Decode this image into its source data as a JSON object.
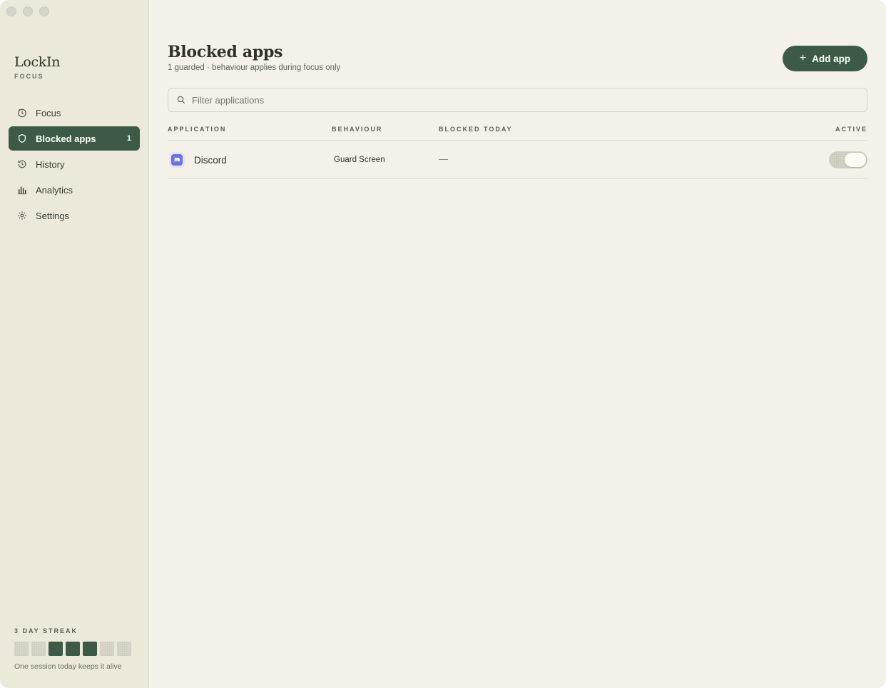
{
  "app": {
    "name": "LockIn",
    "subtitle": "FOCUS"
  },
  "sidebar": {
    "items": [
      {
        "label": "Focus",
        "icon": "timer-icon"
      },
      {
        "label": "Blocked apps",
        "icon": "shield-icon",
        "badge": "1",
        "active": true
      },
      {
        "label": "History",
        "icon": "history-icon"
      },
      {
        "label": "Analytics",
        "icon": "bar-chart-icon"
      },
      {
        "label": "Settings",
        "icon": "gear-icon"
      }
    ],
    "streak": {
      "title": "3 DAY STREAK",
      "days": [
        false,
        false,
        true,
        true,
        true,
        false,
        false
      ],
      "note": "One session today keeps it alive"
    }
  },
  "main": {
    "title": "Blocked apps",
    "subtitle": "1 guarded · behaviour applies during focus only",
    "add_button": "Add app",
    "filter_placeholder": "Filter applications",
    "columns": {
      "application": "APPLICATION",
      "behaviour": "BEHAVIOUR",
      "blocked_today": "BLOCKED TODAY",
      "active": "ACTIVE"
    },
    "rows": [
      {
        "name": "Discord",
        "icon": "discord-icon",
        "behaviour": "Guard Screen",
        "blocked_today": "—",
        "active": true
      }
    ]
  },
  "colors": {
    "accent": "#3c5a46",
    "sidebar_bg": "#ece8da",
    "main_bg": "#f4f1e8",
    "discord": "#6b73e0"
  }
}
